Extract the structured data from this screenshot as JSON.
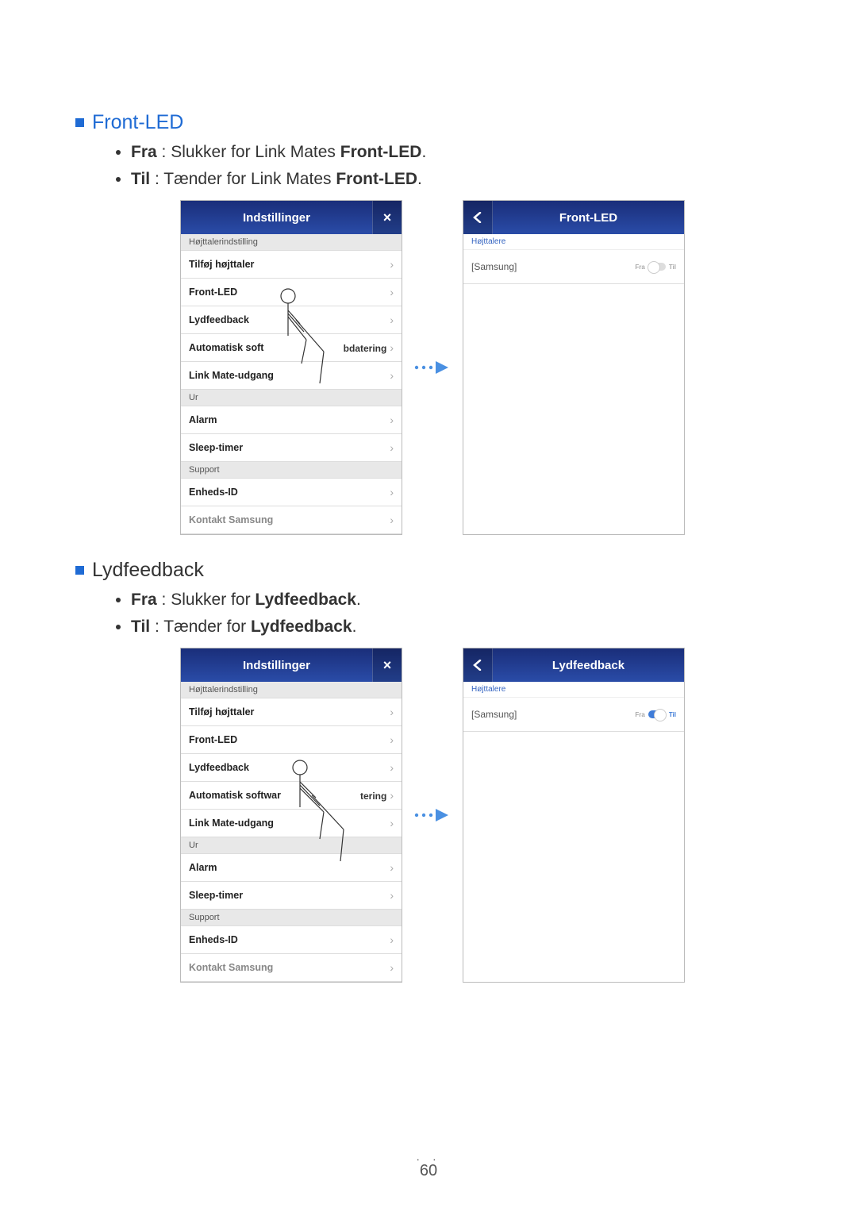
{
  "sections": [
    {
      "title": "Front-LED",
      "color": "blue",
      "bullets": [
        {
          "bold": "Fra",
          "text": " : Slukker for Link Mates ",
          "bold2": "Front-LED",
          "text2": "."
        },
        {
          "bold": "Til",
          "text": " : Tænder for Link Mates ",
          "bold2": "Front-LED",
          "text2": "."
        }
      ],
      "left_screen": {
        "title": "Indstillinger",
        "close": "×",
        "groups": [
          {
            "header": "Højttalerindstilling",
            "items": [
              {
                "label": "Tilføj højttaler"
              },
              {
                "label": "Front-LED"
              },
              {
                "label": "Lydfeedback"
              },
              {
                "label_pre": "Automatisk soft",
                "label_suf": "bdatering"
              },
              {
                "label": "Link Mate-udgang"
              }
            ]
          },
          {
            "header": "Ur",
            "items": [
              {
                "label": "Alarm"
              },
              {
                "label": "Sleep-timer"
              }
            ]
          },
          {
            "header": "Support",
            "items": [
              {
                "label": "Enheds-ID"
              },
              {
                "label": "Kontakt Samsung"
              }
            ]
          }
        ]
      },
      "right_screen": {
        "title": "Front-LED",
        "sub": "Højttalere",
        "item_label": "[Samsung]",
        "off_label": "Fra",
        "on_label": "Til",
        "state": "off"
      }
    },
    {
      "title": "Lydfeedback",
      "color": "black",
      "bullets": [
        {
          "bold": "Fra",
          "text": " : Slukker for ",
          "bold2": "Lydfeedback",
          "text2": "."
        },
        {
          "bold": "Til",
          "text": " : Tænder for ",
          "bold2": "Lydfeedback",
          "text2": "."
        }
      ],
      "left_screen": {
        "title": "Indstillinger",
        "close": "×",
        "groups": [
          {
            "header": "Højttalerindstilling",
            "items": [
              {
                "label": "Tilføj højttaler"
              },
              {
                "label": "Front-LED"
              },
              {
                "label": "Lydfeedback"
              },
              {
                "label_pre": "Automatisk softwar",
                "label_suf": "tering"
              },
              {
                "label": "Link Mate-udgang"
              }
            ]
          },
          {
            "header": "Ur",
            "items": [
              {
                "label": "Alarm"
              },
              {
                "label": "Sleep-timer"
              }
            ]
          },
          {
            "header": "Support",
            "items": [
              {
                "label": "Enheds-ID"
              },
              {
                "label": "Kontakt Samsung"
              }
            ]
          }
        ]
      },
      "right_screen": {
        "title": "Lydfeedback",
        "sub": "Højttalere",
        "item_label": "[Samsung]",
        "off_label": "Fra",
        "on_label": "Til",
        "state": "on"
      }
    }
  ],
  "page_number": "60"
}
